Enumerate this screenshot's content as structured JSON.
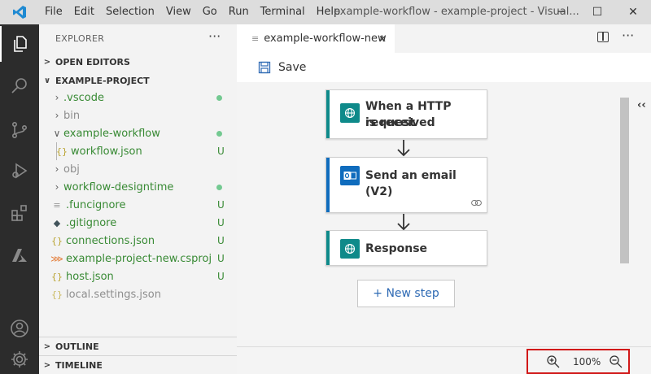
{
  "titlebar": {
    "menu": [
      "File",
      "Edit",
      "Selection",
      "View",
      "Go",
      "Run",
      "Terminal",
      "Help"
    ],
    "title": "example-workflow - example-project - Visual...",
    "minimize": "─",
    "maximize": "☐",
    "close": "✕"
  },
  "sidebar": {
    "title": "EXPLORER",
    "more": "···",
    "open_editors": "OPEN EDITORS",
    "project": "EXAMPLE-PROJECT",
    "items": [
      {
        "label": ".vscode",
        "status": "●"
      },
      {
        "label": "bin",
        "status": ""
      },
      {
        "label": "example-workflow",
        "status": "●"
      },
      {
        "label": "workflow.json",
        "status": "U"
      },
      {
        "label": "obj",
        "status": ""
      },
      {
        "label": "workflow-designtime",
        "status": "●"
      },
      {
        "label": ".funcignore",
        "status": "U"
      },
      {
        "label": ".gitignore",
        "status": "U"
      },
      {
        "label": "connections.json",
        "status": "U"
      },
      {
        "label": "example-project-new.csproj",
        "status": "U"
      },
      {
        "label": "host.json",
        "status": "U"
      },
      {
        "label": "local.settings.json",
        "status": ""
      }
    ],
    "outline": "OUTLINE",
    "timeline": "TIMELINE"
  },
  "editor": {
    "tab_label": "example-workflow-new",
    "tab_close": "✕",
    "more": "···",
    "save_label": "Save"
  },
  "designer": {
    "steps": [
      {
        "title_line1": "When a HTTP request",
        "title_line2": "is received"
      },
      {
        "title_line1": "Send an email (V2)",
        "title_line2": ""
      },
      {
        "title_line1": "Response",
        "title_line2": ""
      }
    ],
    "new_step": "+ New step",
    "collapse": "‹‹"
  },
  "zoom": {
    "value": "100%"
  },
  "colors": {
    "accent_teal": "#0e8a8a",
    "outlook_blue": "#0f6cbd",
    "activity_bg": "#2c2c2c",
    "highlight_red": "#d11818",
    "git_green": "#388a34"
  }
}
